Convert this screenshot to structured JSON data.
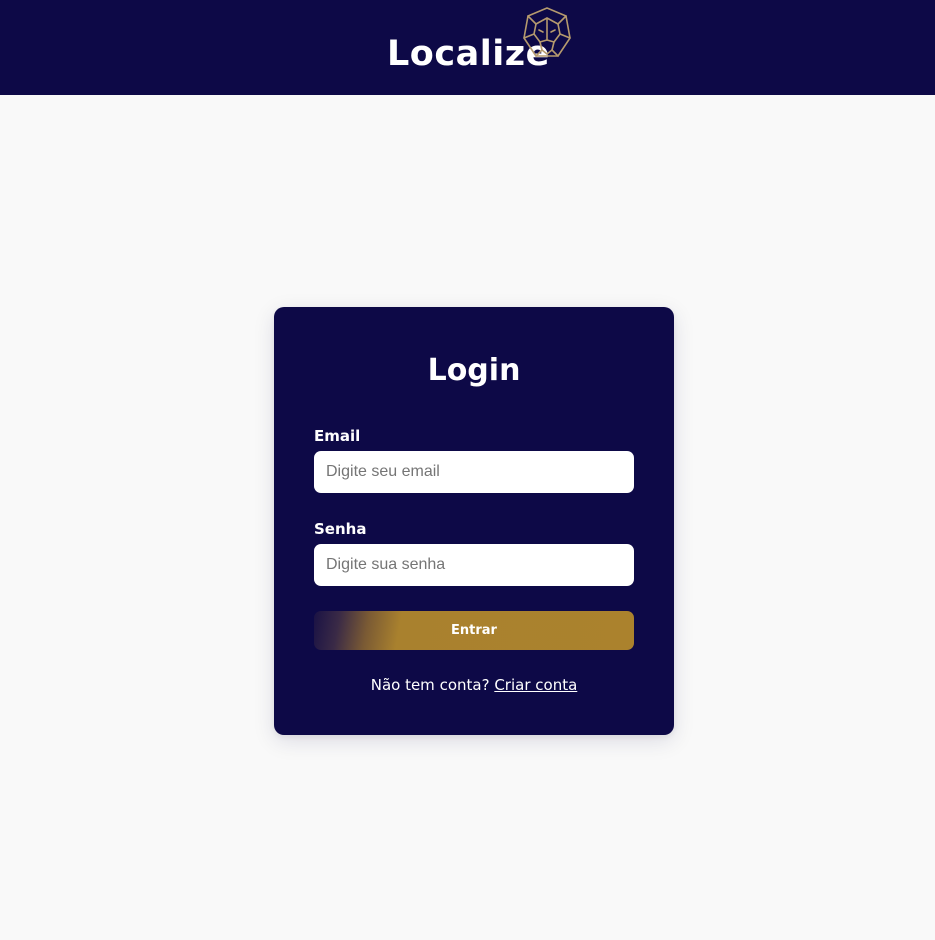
{
  "header": {
    "brand_text": "Localize",
    "brand_icon": "lion-head-geometric-icon"
  },
  "login": {
    "title": "Login",
    "email_label": "Email",
    "email_placeholder": "Digite seu email",
    "email_value": "",
    "password_label": "Senha",
    "password_placeholder": "Digite sua senha",
    "password_value": "",
    "submit_label": "Entrar",
    "signup_prompt": "Não tem conta?",
    "signup_link": "Criar conta"
  },
  "colors": {
    "navy": "#0d0947",
    "gold": "#ab822d",
    "page_background": "#f9f9f9",
    "logo_line": "#b59a6e"
  }
}
